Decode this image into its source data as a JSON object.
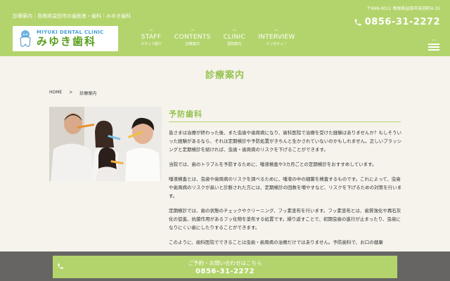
{
  "header": {
    "tagline": "診療案内｜島根県益田市の歯医者・歯科｜みゆき歯科",
    "address": "〒698-0011 島根県益田市染羽町4-35",
    "phone": "0856-31-2272",
    "logo_en": "MIYUKI DENTAL CLINIC",
    "logo_ja": "みゆき歯科"
  },
  "nav": [
    {
      "en": "STAFF",
      "ja": "スタッフ紹介"
    },
    {
      "en": "CONTENTS",
      "ja": "診療案内"
    },
    {
      "en": "CLINIC",
      "ja": "医院案内"
    },
    {
      "en": "INTERVIEW",
      "ja": "インタビュー"
    }
  ],
  "page": {
    "title": "診療案内",
    "breadcrumb_home": "HOME",
    "breadcrumb_sep": ">",
    "breadcrumb_current": "診療案内"
  },
  "section": {
    "title": "予防歯科",
    "paragraphs": [
      "皆さまは治療が終わった後、また虫歯や歯周病になり、歯科医院で治療を受けた経験はありませんか？もしそういった経験があるなら、それは定期検診や予防処置がきちんと生かされていないのかもしれません。正しいブラッシングと定期検診を続ければ、虫歯・歯周病のリスクを下げることができます。",
      "当院では、歯のトラブルを予防するために、唾液検査や3カ月ごとの定期検診をおすすめしています。",
      "唾液検査とは、虫歯や歯周病のリスクを調べるために、唾液の中の細菌を検査するものです。これによって、虫歯や歯周病のリスクが高いと診断された方には、定期検診の回数を増やすなど、リスクを下げるための対策を行います。",
      "定期検診では、歯の状態のチェックやクリーニング、フッ素塗布を行います。フッ素塗布とは、歯質強化や再石灰化の促進、抗菌作用があるフッ化物を塗布する処置です。繰り返すことで、初期虫歯の進行が止まったり、虫歯になりにくい歯にしたりすることができます。",
      "このように、歯科医院でできることは虫歯・歯周病の治療だけではありません。予防歯科で、お口の健康"
    ]
  },
  "cta": {
    "lead": "ご予約・お問い合わせはこちら",
    "tel": "0856-31-2272"
  },
  "colors": {
    "accent": "#b3d46c",
    "accent_text": "#96c24f",
    "background": "#f6f3ec"
  }
}
